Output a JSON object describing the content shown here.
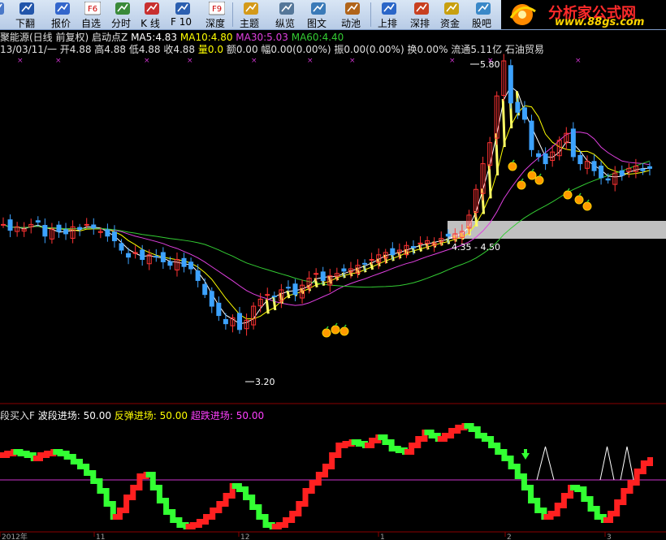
{
  "toolbar": {
    "buttons": [
      {
        "label": "间",
        "icon": "toolbar-icon"
      },
      {
        "label": "下翻",
        "icon": "down-arrow-icon"
      },
      {
        "label": "报价",
        "icon": "quote-icon"
      },
      {
        "label": "自选",
        "icon": "f6-icon",
        "key": "F6"
      },
      {
        "label": "分时",
        "icon": "timeshare-icon"
      },
      {
        "label": "K 线",
        "icon": "kline-icon"
      },
      {
        "label": "F 10",
        "icon": "f10-icon"
      },
      {
        "label": "深度",
        "icon": "f9-icon",
        "key": "F9"
      },
      {
        "label": "主题",
        "icon": "home-icon"
      },
      {
        "label": "纵览",
        "icon": "overview-icon"
      },
      {
        "label": "图文",
        "icon": "graphic-icon"
      },
      {
        "label": "动池",
        "icon": "pool-icon"
      },
      {
        "label": "上排",
        "icon": "up-rank-icon"
      },
      {
        "label": "深排",
        "icon": "deep-rank-icon"
      },
      {
        "label": "资金",
        "icon": "fund-icon"
      },
      {
        "label": "股吧",
        "icon": "forum-icon"
      }
    ],
    "logo_title": "分析家公式网",
    "logo_url": "www.88gs.com"
  },
  "header": {
    "line1": {
      "name": "聚能源(日线 前复权)",
      "indicator": "启动点Z",
      "ma5_label": "MA5:",
      "ma5": "4.83",
      "ma10_label": "MA10:",
      "ma10": "4.80",
      "ma30_label": "MA30:",
      "ma30": "5.03",
      "ma60_label": "MA60:",
      "ma60": "4.40"
    },
    "line2": "13/03/11/一 开4.88 高4.88 低4.88 收4.88",
    "line2_vol_label": "量",
    "line2_vol": "0.0",
    "line2_amt_label": "额",
    "line2_amt": "0.00",
    "line2_rest": "幅0.00(0.00%) 振0.00(0.00%) 换0.00% 流通5.11亿 石油贸易"
  },
  "price_chart": {
    "high_label": "5.80",
    "low_label": "3.20",
    "zone_label": "4.35 - 4.50",
    "colors": {
      "up": "#ff3333",
      "down": "#3da3ff",
      "ma5": "#ffffff",
      "ma10": "#ffff00",
      "ma30": "#e040e0",
      "ma60": "#33cc33",
      "zone": "#c0c0c0"
    }
  },
  "sub_chart": {
    "title": "段买入F",
    "wave_label": "波段进场:",
    "wave_value": "50.00",
    "rebound_label": "反弹进场:",
    "rebound_value": "50.00",
    "super_label": "超跌进场:",
    "super_value": "50.00",
    "colors": {
      "green": "#33ff33",
      "red": "#ff2020",
      "level": "#cc33cc"
    }
  },
  "axis": {
    "labels": [
      "2012年",
      "11",
      "12",
      "1",
      "2",
      "3"
    ]
  }
}
